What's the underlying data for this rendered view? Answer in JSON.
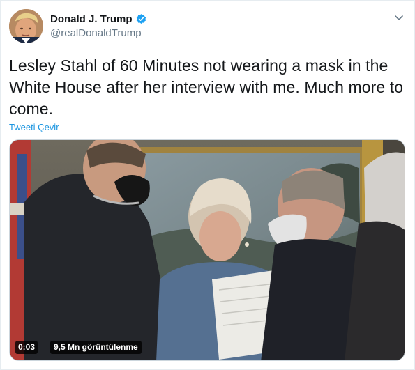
{
  "author": {
    "display_name": "Donald J. Trump",
    "handle": "@realDonaldTrump",
    "verified": true,
    "avatar_icon": "profile-photo"
  },
  "tweet": {
    "text": "Lesley Stahl of 60 Minutes not wearing a mask in the White House after her interview with me. Much more to come.",
    "translate_label": "Tweeti Çevir"
  },
  "media": {
    "type": "video",
    "duration": "0:03",
    "views": "9,5 Mn görüntülenme"
  },
  "icons": {
    "verified": "verified-badge-icon",
    "more": "chevron-down-icon"
  },
  "colors": {
    "link": "#1b95e0",
    "verified": "#1da1f2",
    "secondary_text": "#657786",
    "primary_text": "#14171a"
  }
}
